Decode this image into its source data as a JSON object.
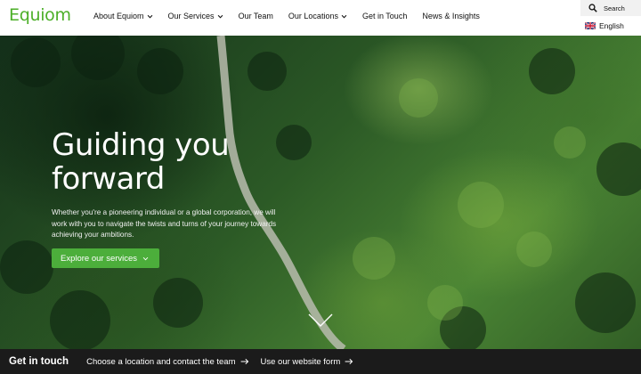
{
  "header": {
    "logo": "Equiom",
    "nav": [
      {
        "label": "About Equiom",
        "dropdown": true
      },
      {
        "label": "Our Services",
        "dropdown": true
      },
      {
        "label": "Our Team",
        "dropdown": false
      },
      {
        "label": "Our Locations",
        "dropdown": true
      },
      {
        "label": "Get in Touch",
        "dropdown": false
      },
      {
        "label": "News & Insights",
        "dropdown": false
      }
    ],
    "search_label": "Search",
    "language": "English"
  },
  "hero": {
    "title_line1": "Guiding you",
    "title_line2": "forward",
    "description": "Whether you're a pioneering individual or a global corporation, we will work with you to navigate the twists and turns of your journey towards achieving your ambitions.",
    "cta_label": "Explore our services"
  },
  "get_in_touch": {
    "title": "Get in touch",
    "links": [
      "Choose a location and contact the team",
      "Use our website form"
    ]
  },
  "colors": {
    "brand_green": "#4cae3b",
    "logo_green": "#4caf28",
    "footer_bg": "#1b1b1b"
  },
  "icons": [
    "search-icon",
    "uk-flag-icon",
    "chevron-down-icon",
    "arrow-right-icon",
    "scroll-down-chevron-icon"
  ]
}
